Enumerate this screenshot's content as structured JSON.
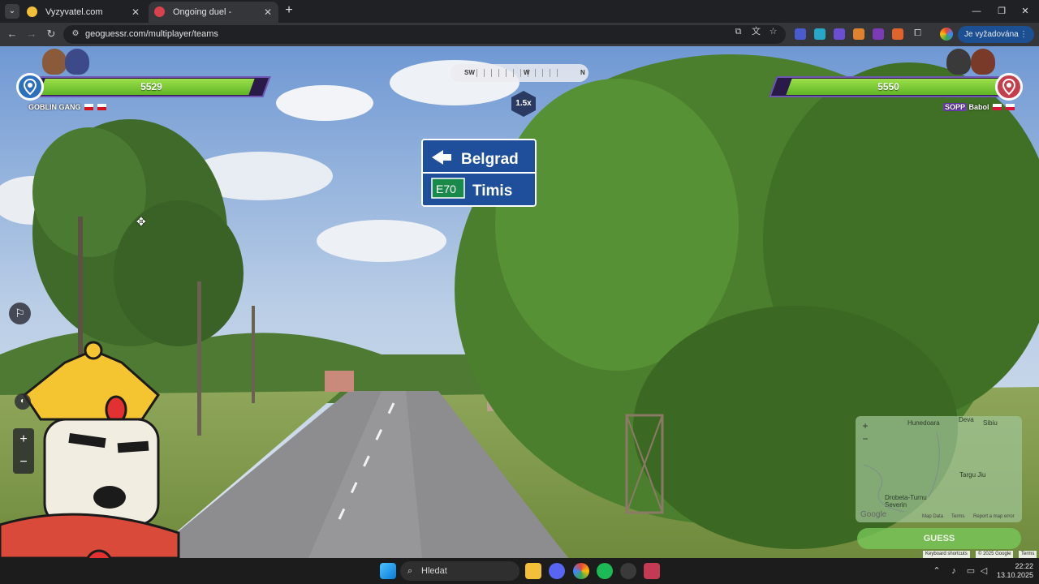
{
  "browser": {
    "tabs": [
      {
        "title": "Vyzyvatel.com",
        "active": false
      },
      {
        "title": "Ongoing duel - GeoGuessr",
        "active": true
      }
    ],
    "url": "geoguessr.com/multiplayer/teams",
    "action_button": "Je vyžadována akce"
  },
  "game": {
    "team_left": {
      "name": "GOBLIN GANG",
      "health": "5529",
      "health_fraction": 0.91,
      "color": "#2c6fbd"
    },
    "team_right": {
      "name": "Babol",
      "tag": "SOPP",
      "health": "5550",
      "health_fraction": 0.92,
      "color": "#c53e4c"
    },
    "compass": {
      "labels": [
        "SW",
        "W",
        "N"
      ]
    },
    "multiplier": "1.5x",
    "road_sign": {
      "destination_1": "Belgrad",
      "route": "E70",
      "destination_2": "Timis"
    },
    "minimap": {
      "places": [
        "Hunedoara",
        "Deva",
        "Sibiu",
        "Targu Jiu",
        "Drobeta-Turnu Severin"
      ],
      "attribution": [
        "Google",
        "Map Data",
        "Terms",
        "Report a map error"
      ]
    },
    "guess_button": "GUESS",
    "footer": [
      "Keyboard shortcuts",
      "© 2025 Google",
      "Terms"
    ]
  },
  "taskbar": {
    "search": "Hledat",
    "time": "22:22",
    "date": "13.10.2025"
  }
}
